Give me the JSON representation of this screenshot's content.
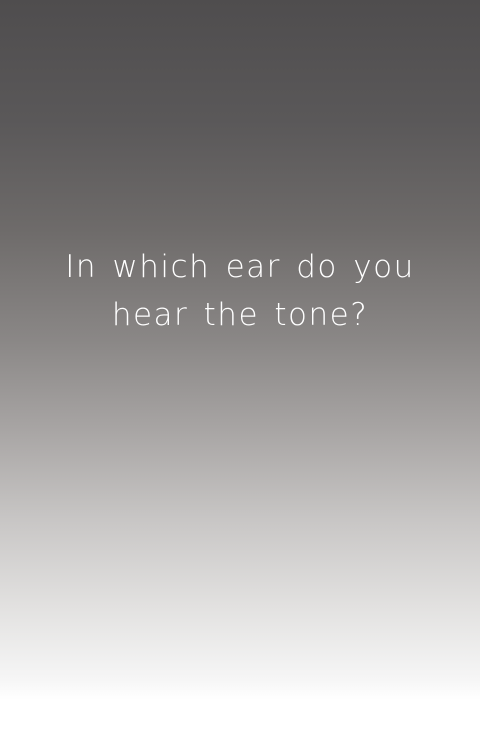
{
  "question": {
    "line1": "In which ear do you",
    "line2": "hear the tone?"
  }
}
